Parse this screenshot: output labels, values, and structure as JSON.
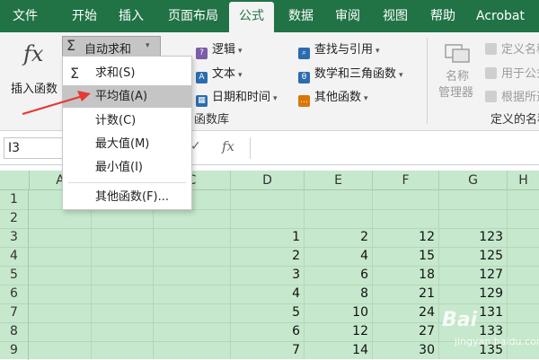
{
  "tabs": [
    "文件",
    "开始",
    "插入",
    "页面布局",
    "公式",
    "数据",
    "审阅",
    "视图",
    "帮助",
    "Acrobat"
  ],
  "active_tab": "公式",
  "ribbon": {
    "insert_function": {
      "icon": "fx",
      "label": "插入函数"
    },
    "autosum": {
      "icon": "Σ",
      "label": "自动求和"
    },
    "logical": "逻辑",
    "text": "文本",
    "datetime": "日期和时间",
    "lookup": "查找与引用",
    "math": "数学和三角函数",
    "more": "其他函数",
    "function_library_label": "函数库",
    "name_manager": [
      "名称",
      "管理器"
    ],
    "define_name": "定义名称",
    "use_in_formula": "用于公式",
    "create_from_selection": "根据所选",
    "defined_names_label": "定义的名称"
  },
  "formula_bar": {
    "name_box": "I3",
    "fx": "fx"
  },
  "autosum_menu": {
    "sum_icon": "Σ",
    "items": [
      "求和(S)",
      "平均值(A)",
      "计数(C)",
      "最大值(M)",
      "最小值(I)",
      "其他函数(F)..."
    ],
    "highlighted_index": 1
  },
  "columns": [
    "A",
    "B",
    "C",
    "D",
    "E",
    "F",
    "G",
    "H"
  ],
  "rows": [
    "1",
    "2",
    "3",
    "4",
    "5",
    "6",
    "7",
    "8",
    "9"
  ],
  "data": {
    "D": [
      "1",
      "2",
      "3",
      "4",
      "5",
      "6",
      "7"
    ],
    "E": [
      "2",
      "4",
      "6",
      "8",
      "10",
      "12",
      "14"
    ],
    "F": [
      "12",
      "15",
      "18",
      "21",
      "24",
      "27",
      "30"
    ],
    "G": [
      "123",
      "125",
      "127",
      "129",
      "131",
      "133",
      "135"
    ]
  },
  "watermark": [
    "Bai",
    "jingyan.baidu.com"
  ],
  "colors": {
    "excel_green": "#217346",
    "sheet_fill": "#c6e8cc",
    "arrow": "#e53935"
  }
}
